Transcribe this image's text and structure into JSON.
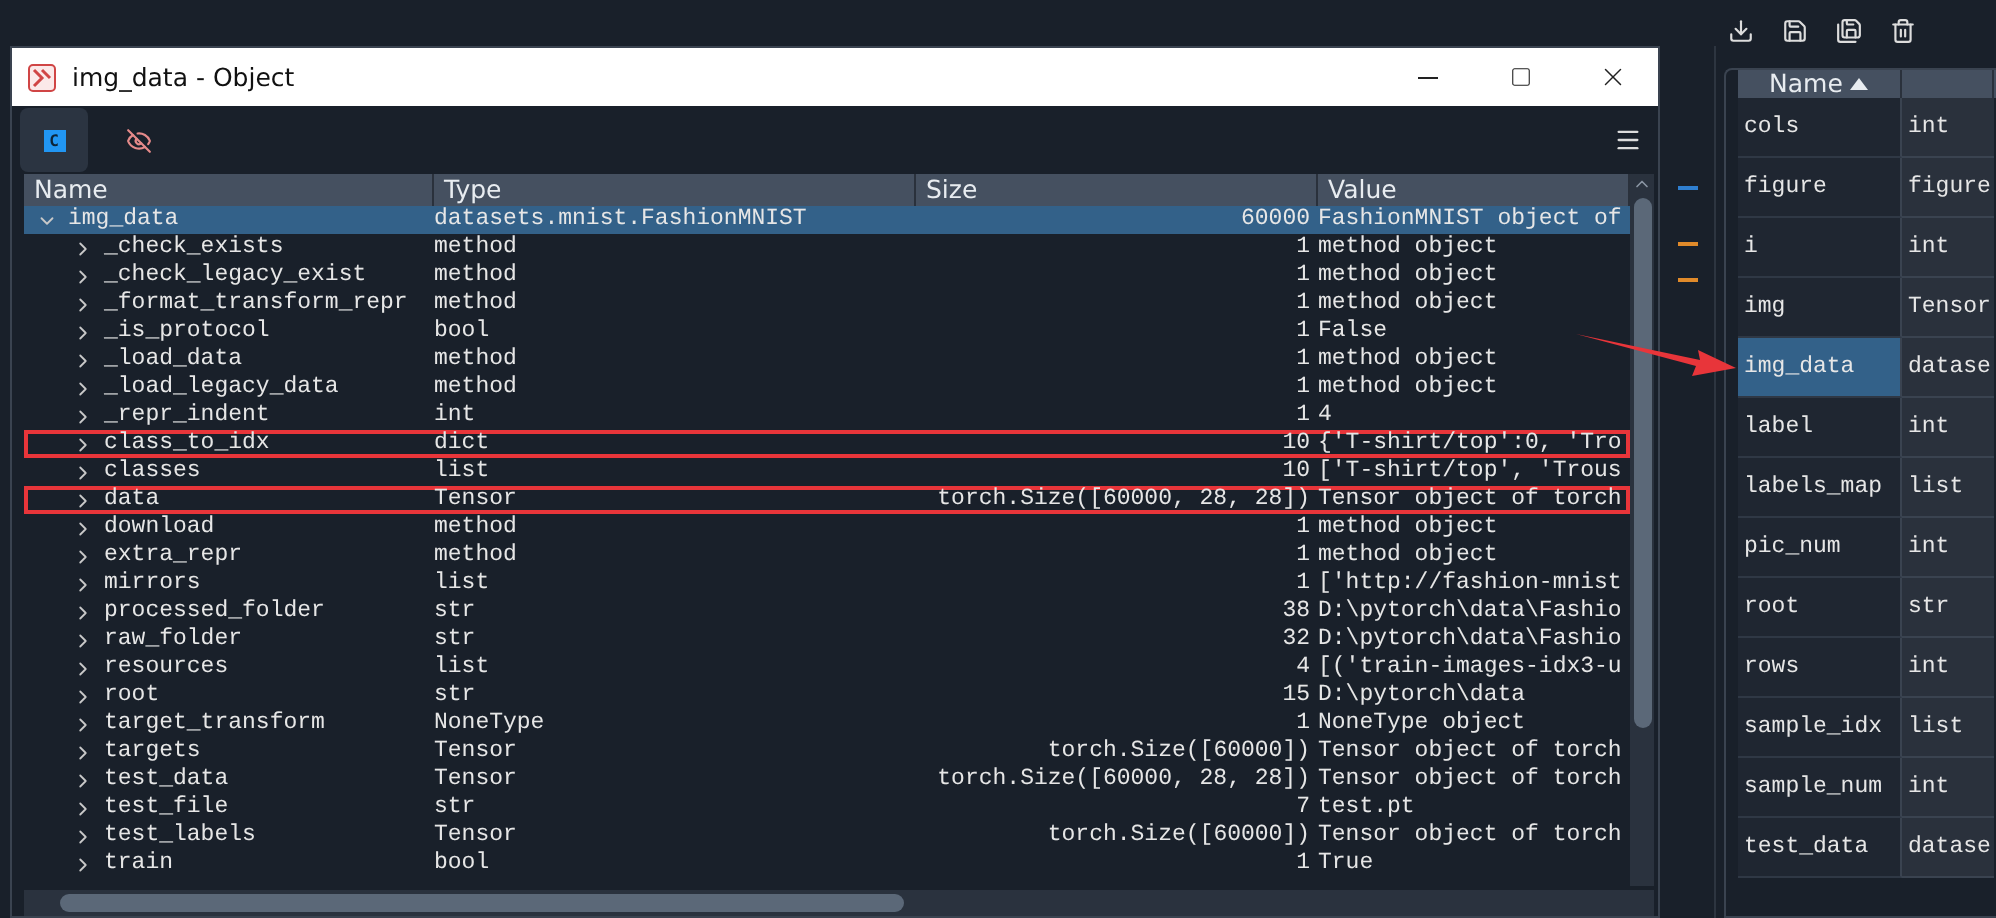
{
  "dialog": {
    "title": "img_data - Object",
    "toolbar": [
      {
        "kind": "class",
        "label": "C",
        "selected": true
      },
      {
        "kind": "hide",
        "selected": false
      }
    ]
  },
  "table": {
    "columns": [
      "Name",
      "Type",
      "Size",
      "Value"
    ],
    "rows": [
      {
        "name": "img_data",
        "type": "datasets.mnist.FashionMNIST",
        "size": "60000",
        "value": "FashionMNIST object of",
        "expanded": true,
        "selected": true,
        "annotated": false,
        "children": [
          {
            "name": "_check_exists",
            "type": "method",
            "size": "1",
            "value": "method object",
            "expanded": false,
            "selected": false,
            "annotated": false
          },
          {
            "name": "_check_legacy_exist",
            "type": "method",
            "size": "1",
            "value": "method object",
            "expanded": false,
            "selected": false,
            "annotated": false
          },
          {
            "name": "_format_transform_repr",
            "type": "method",
            "size": "1",
            "value": "method object",
            "expanded": false,
            "selected": false,
            "annotated": false
          },
          {
            "name": "_is_protocol",
            "type": "bool",
            "size": "1",
            "value": "False",
            "expanded": false,
            "selected": false,
            "annotated": false
          },
          {
            "name": "_load_data",
            "type": "method",
            "size": "1",
            "value": "method object",
            "expanded": false,
            "selected": false,
            "annotated": false
          },
          {
            "name": "_load_legacy_data",
            "type": "method",
            "size": "1",
            "value": "method object",
            "expanded": false,
            "selected": false,
            "annotated": false
          },
          {
            "name": "_repr_indent",
            "type": "int",
            "size": "1",
            "value": "4",
            "expanded": false,
            "selected": false,
            "annotated": false
          },
          {
            "name": "class_to_idx",
            "type": "dict",
            "size": "10",
            "value": "{'T-shirt/top':0, 'Tro",
            "expanded": false,
            "selected": false,
            "annotated": true
          },
          {
            "name": "classes",
            "type": "list",
            "size": "10",
            "value": "['T-shirt/top', 'Trous",
            "expanded": false,
            "selected": false,
            "annotated": false
          },
          {
            "name": "data",
            "type": "Tensor",
            "size": "torch.Size([60000, 28, 28])",
            "value": "Tensor object of torch",
            "expanded": false,
            "selected": false,
            "annotated": true
          },
          {
            "name": "download",
            "type": "method",
            "size": "1",
            "value": "method object",
            "expanded": false,
            "selected": false,
            "annotated": false
          },
          {
            "name": "extra_repr",
            "type": "method",
            "size": "1",
            "value": "method object",
            "expanded": false,
            "selected": false,
            "annotated": false
          },
          {
            "name": "mirrors",
            "type": "list",
            "size": "1",
            "value": "['http://fashion-mnist",
            "expanded": false,
            "selected": false,
            "annotated": false
          },
          {
            "name": "processed_folder",
            "type": "str",
            "size": "38",
            "value": "D:\\pytorch\\data\\Fashio",
            "expanded": false,
            "selected": false,
            "annotated": false
          },
          {
            "name": "raw_folder",
            "type": "str",
            "size": "32",
            "value": "D:\\pytorch\\data\\Fashio",
            "expanded": false,
            "selected": false,
            "annotated": false
          },
          {
            "name": "resources",
            "type": "list",
            "size": "4",
            "value": "[('train-images-idx3-u",
            "expanded": false,
            "selected": false,
            "annotated": false
          },
          {
            "name": "root",
            "type": "str",
            "size": "15",
            "value": "D:\\pytorch\\data",
            "expanded": false,
            "selected": false,
            "annotated": false
          },
          {
            "name": "target_transform",
            "type": "NoneType",
            "size": "1",
            "value": "NoneType object",
            "expanded": false,
            "selected": false,
            "annotated": false
          },
          {
            "name": "targets",
            "type": "Tensor",
            "size": "torch.Size([60000])",
            "value": "Tensor object of torch",
            "expanded": false,
            "selected": false,
            "annotated": false
          },
          {
            "name": "test_data",
            "type": "Tensor",
            "size": "torch.Size([60000, 28, 28])",
            "value": "Tensor object of torch",
            "expanded": false,
            "selected": false,
            "annotated": false
          },
          {
            "name": "test_file",
            "type": "str",
            "size": "7",
            "value": "test.pt",
            "expanded": false,
            "selected": false,
            "annotated": false
          },
          {
            "name": "test_labels",
            "type": "Tensor",
            "size": "torch.Size([60000])",
            "value": "Tensor object of torch",
            "expanded": false,
            "selected": false,
            "annotated": false
          },
          {
            "name": "train",
            "type": "bool",
            "size": "1",
            "value": "True",
            "expanded": false,
            "selected": false,
            "annotated": false
          }
        ]
      }
    ]
  },
  "explorer": {
    "columns": [
      "Name"
    ],
    "rows": [
      {
        "name": "cols",
        "type": "int",
        "selected": false
      },
      {
        "name": "figure",
        "type": "figure",
        "selected": false
      },
      {
        "name": "i",
        "type": "int",
        "selected": false
      },
      {
        "name": "img",
        "type": "Tensor",
        "selected": false
      },
      {
        "name": "img_data",
        "type": "datase",
        "selected": true
      },
      {
        "name": "label",
        "type": "int",
        "selected": false
      },
      {
        "name": "labels_map",
        "type": "list",
        "selected": false
      },
      {
        "name": "pic_num",
        "type": "int",
        "selected": false
      },
      {
        "name": "root",
        "type": "str",
        "selected": false
      },
      {
        "name": "rows",
        "type": "int",
        "selected": false
      },
      {
        "name": "sample_idx",
        "type": "list",
        "selected": false
      },
      {
        "name": "sample_num",
        "type": "int",
        "selected": false
      },
      {
        "name": "test_data",
        "type": "datase",
        "selected": false
      }
    ]
  }
}
